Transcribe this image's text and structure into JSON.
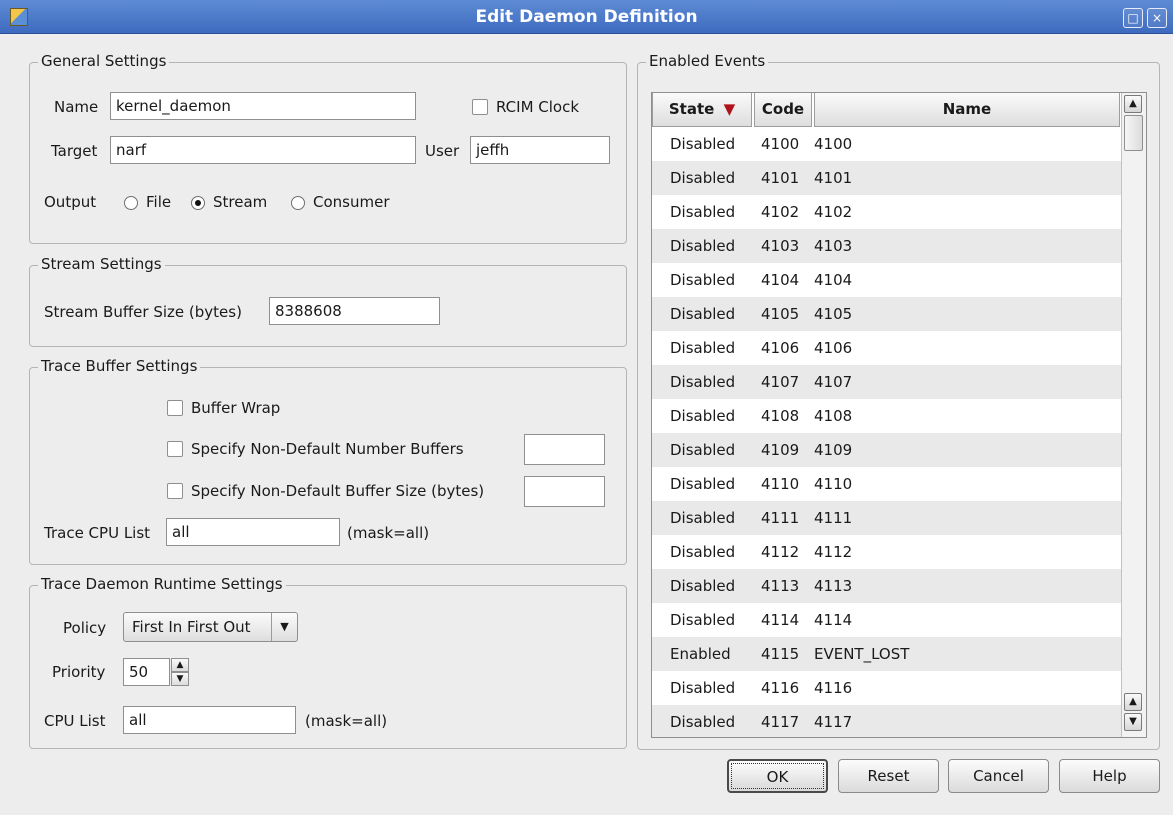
{
  "window": {
    "title": "Edit Daemon Definition",
    "maximize_glyph": "□",
    "close_glyph": "×"
  },
  "general": {
    "label": "General Settings",
    "name_label": "Name",
    "name_value": "kernel_daemon",
    "rcim_label": "RCIM Clock",
    "rcim_checked": false,
    "target_label": "Target",
    "target_value": "narf",
    "user_label": "User",
    "user_value": "jeffh",
    "output_label": "Output",
    "output_options": [
      "File",
      "Stream",
      "Consumer"
    ],
    "output_selected": "Stream"
  },
  "stream": {
    "label": "Stream Settings",
    "buffer_size_label": "Stream Buffer Size (bytes)",
    "buffer_size_value": "8388608"
  },
  "trace_buffer": {
    "label": "Trace Buffer Settings",
    "buffer_wrap_label": "Buffer Wrap",
    "num_buffers_label": "Specify Non-Default Number Buffers",
    "num_buffers_value": "",
    "buffer_size_label": "Specify Non-Default Buffer Size (bytes)",
    "buffer_size_value": "",
    "cpu_list_label": "Trace CPU List",
    "cpu_list_value": "all",
    "cpu_mask": "(mask=all)"
  },
  "runtime": {
    "label": "Trace Daemon Runtime Settings",
    "policy_label": "Policy",
    "policy_value": "First In First Out",
    "priority_label": "Priority",
    "priority_value": "50",
    "cpu_list_label": "CPU List",
    "cpu_list_value": "all",
    "cpu_mask": "(mask=all)"
  },
  "events": {
    "label": "Enabled Events",
    "columns": {
      "state": "State",
      "code": "Code",
      "name": "Name"
    },
    "sort_indicator": "▼",
    "rows": [
      {
        "state": "Disabled",
        "code": "4100",
        "name": "4100"
      },
      {
        "state": "Disabled",
        "code": "4101",
        "name": "4101"
      },
      {
        "state": "Disabled",
        "code": "4102",
        "name": "4102"
      },
      {
        "state": "Disabled",
        "code": "4103",
        "name": "4103"
      },
      {
        "state": "Disabled",
        "code": "4104",
        "name": "4104"
      },
      {
        "state": "Disabled",
        "code": "4105",
        "name": "4105"
      },
      {
        "state": "Disabled",
        "code": "4106",
        "name": "4106"
      },
      {
        "state": "Disabled",
        "code": "4107",
        "name": "4107"
      },
      {
        "state": "Disabled",
        "code": "4108",
        "name": "4108"
      },
      {
        "state": "Disabled",
        "code": "4109",
        "name": "4109"
      },
      {
        "state": "Disabled",
        "code": "4110",
        "name": "4110"
      },
      {
        "state": "Disabled",
        "code": "4111",
        "name": "4111"
      },
      {
        "state": "Disabled",
        "code": "4112",
        "name": "4112"
      },
      {
        "state": "Disabled",
        "code": "4113",
        "name": "4113"
      },
      {
        "state": "Disabled",
        "code": "4114",
        "name": "4114"
      },
      {
        "state": "Enabled",
        "code": "4115",
        "name": "EVENT_LOST"
      },
      {
        "state": "Disabled",
        "code": "4116",
        "name": "4116"
      },
      {
        "state": "Disabled",
        "code": "4117",
        "name": "4117"
      }
    ]
  },
  "buttons": {
    "ok": "OK",
    "reset": "Reset",
    "cancel": "Cancel",
    "help": "Help"
  },
  "colors": {
    "title_bar": "#4a78c9",
    "sort_arrow": "#b0121b",
    "alt_row": "#e9e9e9"
  }
}
